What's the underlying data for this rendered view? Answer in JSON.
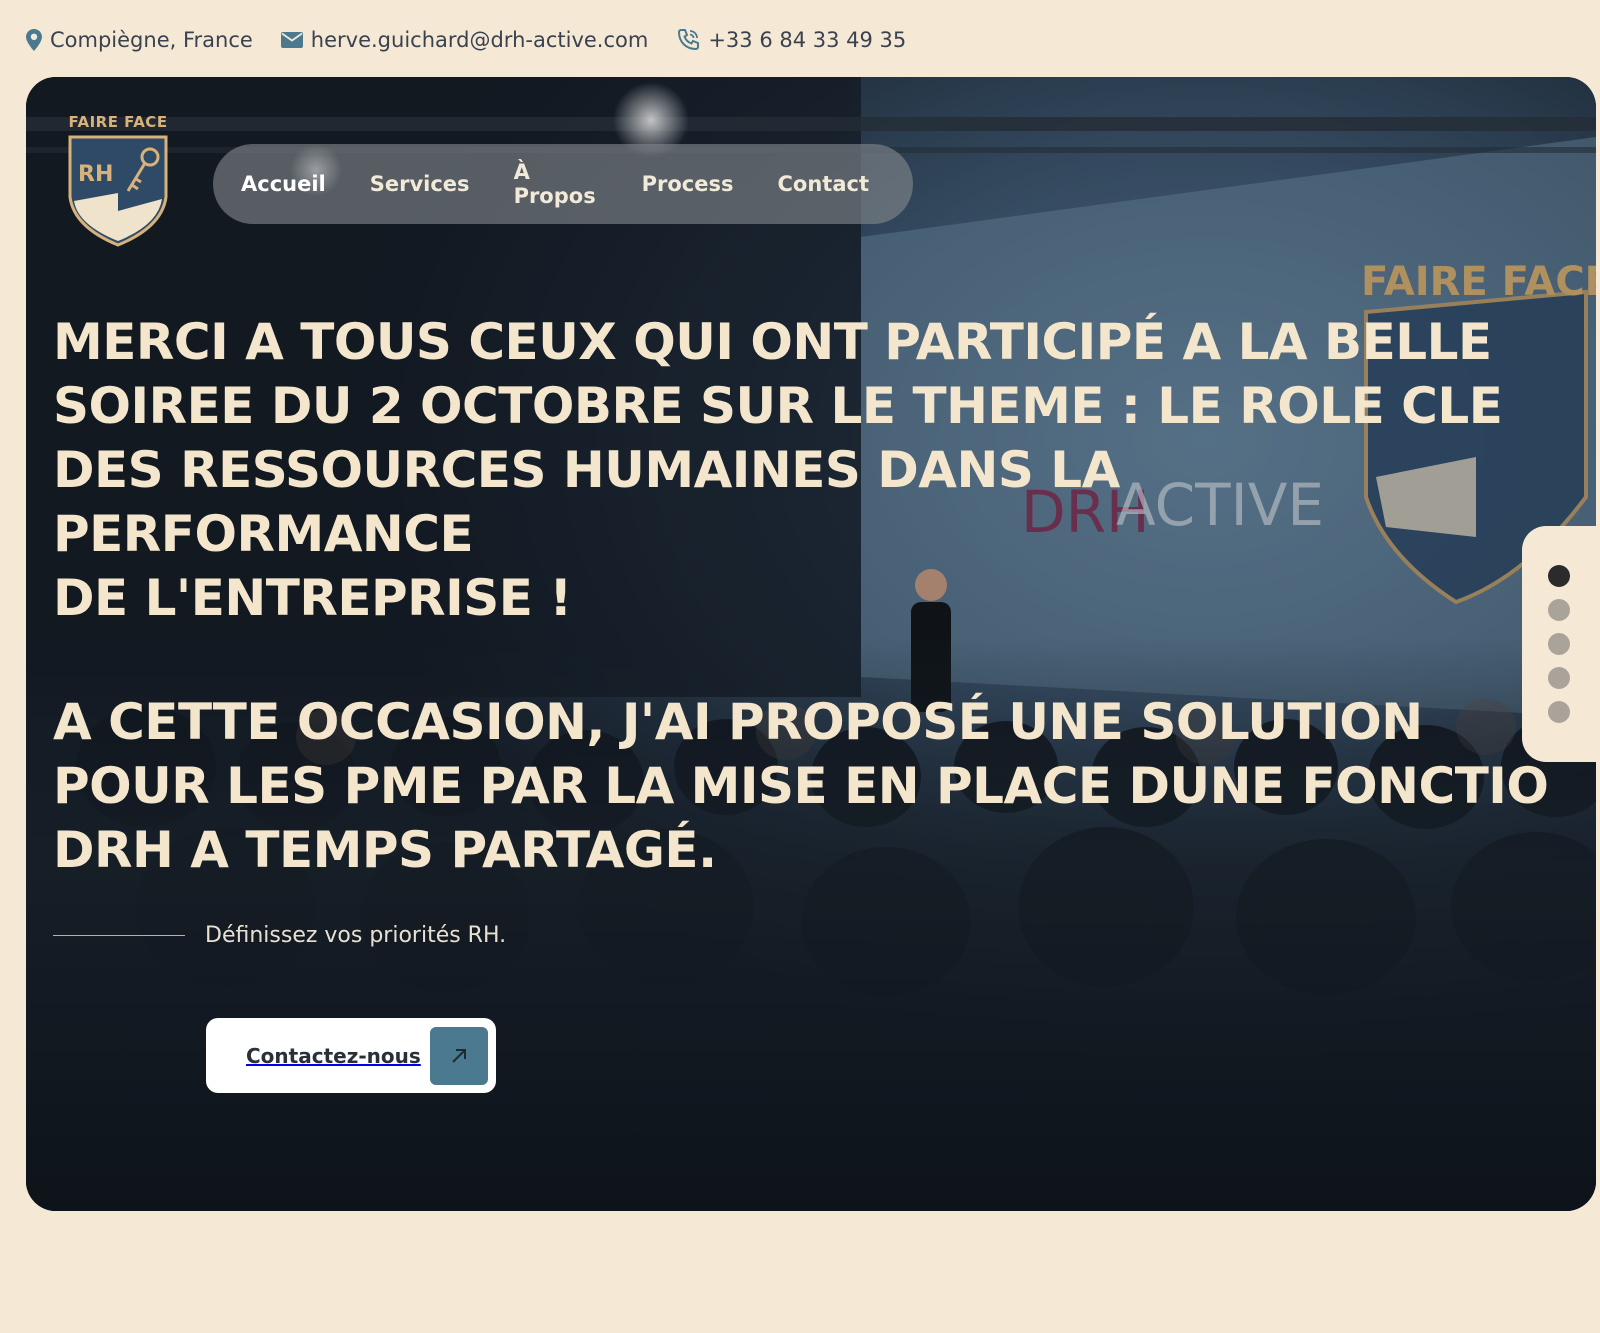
{
  "topbar": {
    "location": "Compiègne, France",
    "email": "herve.guichard@drh-active.com",
    "phone": "+33 6 84 33 49 35"
  },
  "logo": {
    "text": "FAIRE FACE",
    "emblem_text": "RH"
  },
  "nav": {
    "items": [
      "Accueil",
      "Services",
      "À Propos",
      "Process",
      "Contact"
    ],
    "active": "Accueil"
  },
  "hero": {
    "headline_1": "MERCI A TOUS CEUX QUI ONT PARTICIPÉ A LA BELLE\nSOIREE DU 2 OCTOBRE SUR LE THEME : LE ROLE CLE\nDES RESSOURCES HUMAINES DANS LA PERFORMANCE\nDE L'ENTREPRISE !",
    "headline_2": "A CETTE OCCASION, J'AI PROPOSÉ UNE SOLUTION\nPOUR LES PME PAR LA MISE EN PLACE DUNE FONCTIO\nDRH A TEMPS PARTAGÉ.",
    "tagline": "Définissez vos priorités RH.",
    "cta_label": "Contactez-nous",
    "stage_screen_text": "FAIRE FACE",
    "stage_brand_left": "DRH",
    "stage_brand_right": "ACTIVE"
  },
  "slider": {
    "count": 5,
    "active_index": 0
  },
  "colors": {
    "page_bg": "#f5e9d6",
    "headline": "#f4e6cc",
    "accent": "#4b7a90",
    "logo_gold": "#d7b27a"
  }
}
